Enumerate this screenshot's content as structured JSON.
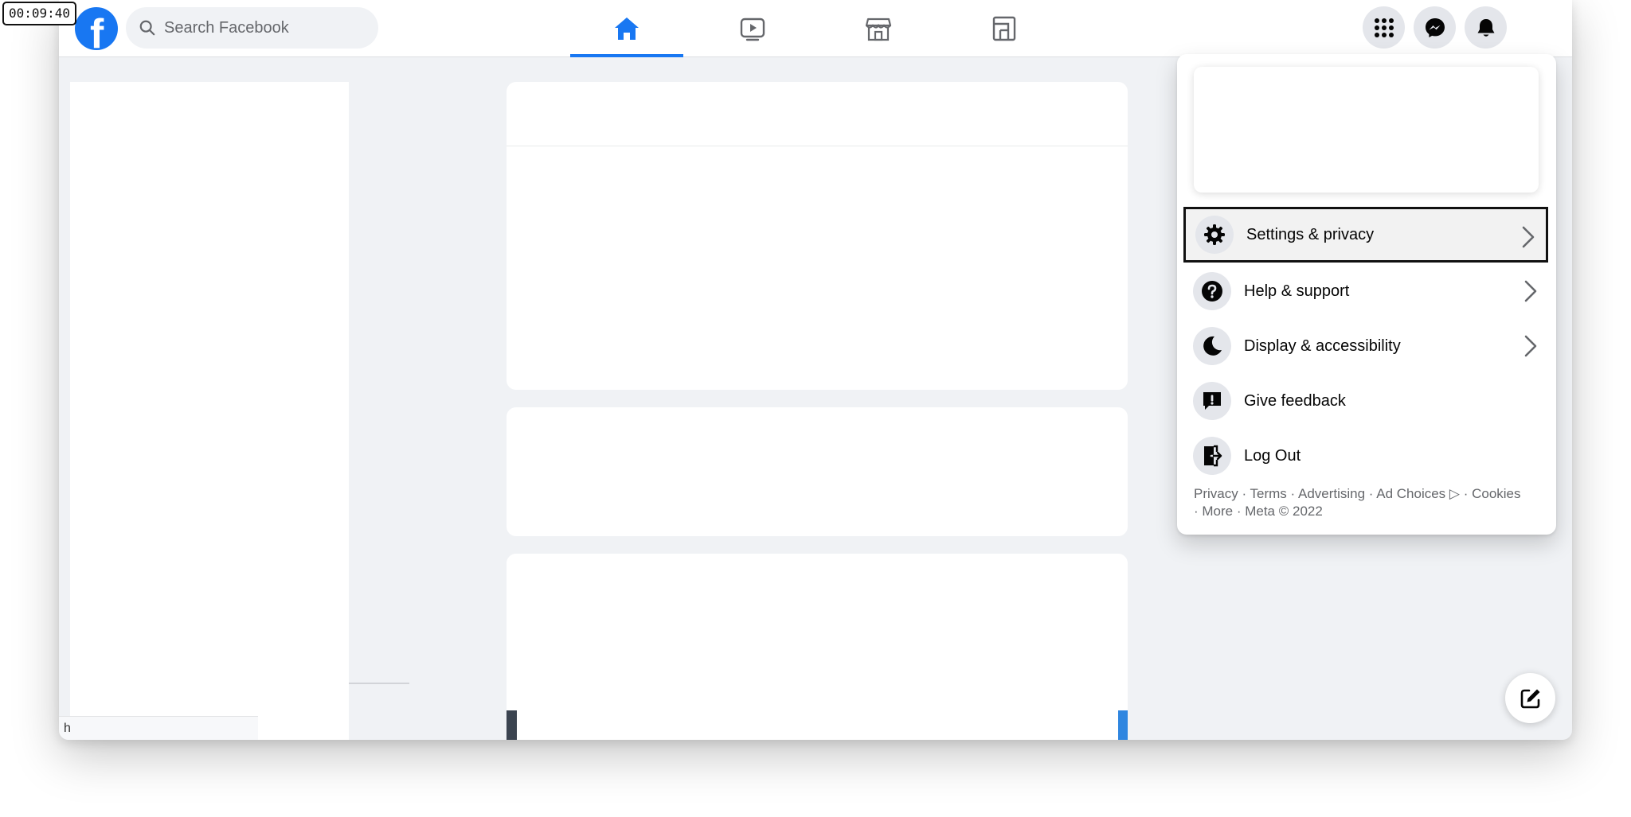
{
  "timer": "00:09:40",
  "header": {
    "logo_letter": "f",
    "search_placeholder": "Search Facebook",
    "nav_tabs": [
      {
        "name": "home",
        "active": true
      },
      {
        "name": "watch",
        "active": false
      },
      {
        "name": "marketplace",
        "active": false
      },
      {
        "name": "gaming",
        "active": false
      }
    ],
    "right_icons": [
      "menu-grid-icon",
      "messenger-icon",
      "notifications-bell-icon"
    ]
  },
  "menu": {
    "items": [
      {
        "label": "Settings & privacy",
        "icon": "gear-icon",
        "has_chevron": true,
        "focused": true
      },
      {
        "label": "Help & support",
        "icon": "question-icon",
        "has_chevron": true,
        "focused": false
      },
      {
        "label": "Display & accessibility",
        "icon": "moon-icon",
        "has_chevron": true,
        "focused": false
      },
      {
        "label": "Give feedback",
        "icon": "feedback-icon",
        "has_chevron": false,
        "focused": false
      },
      {
        "label": "Log Out",
        "icon": "logout-icon",
        "has_chevron": false,
        "focused": false
      }
    ],
    "footer": {
      "line1": "Privacy · Terms · Advertising · Ad Choices ▷ · Cookies",
      "line2": "· More · Meta © 2022"
    }
  },
  "status_strip": "h",
  "colors": {
    "brand_blue": "#1877f2",
    "page_background": "#f0f2f5",
    "icon_circle": "#e4e6eb"
  }
}
